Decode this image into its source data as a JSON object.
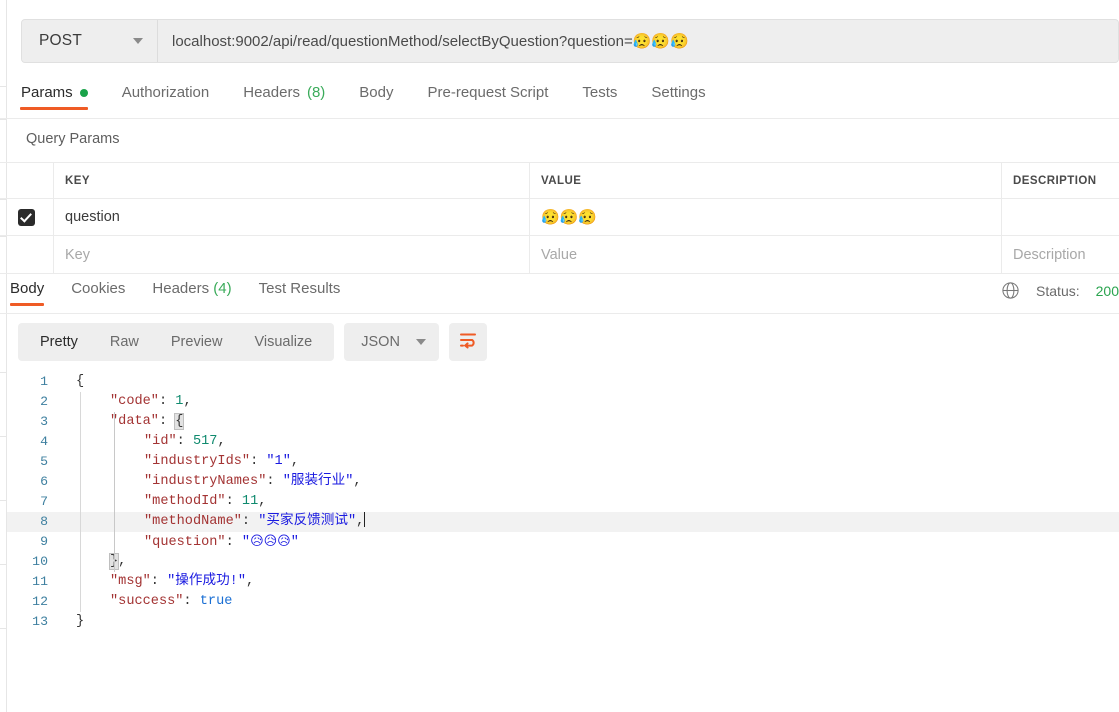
{
  "request": {
    "method": "POST",
    "method_caret": "chevron-down-icon",
    "url": "localhost:9002/api/read/questionMethod/selectByQuestion?question=",
    "url_emoji": "😥😥😥",
    "tabs": [
      {
        "label": "Params",
        "badge_dot": true,
        "active": true
      },
      {
        "label": "Authorization",
        "active": false
      },
      {
        "label": "Headers",
        "count": "(8)",
        "active": false
      },
      {
        "label": "Body",
        "active": false
      },
      {
        "label": "Pre-request Script",
        "active": false
      },
      {
        "label": "Tests",
        "active": false
      },
      {
        "label": "Settings",
        "active": false
      }
    ]
  },
  "query_params": {
    "section_title": "Query Params",
    "columns": [
      "KEY",
      "VALUE",
      "DESCRIPTION"
    ],
    "rows": [
      {
        "checked": true,
        "key": "question",
        "value": "😥😥😥",
        "description": ""
      }
    ],
    "new_row": {
      "key_placeholder": "Key",
      "value_placeholder": "Value",
      "description_placeholder": "Description"
    }
  },
  "response": {
    "tabs": [
      {
        "label": "Body",
        "active": true
      },
      {
        "label": "Cookies",
        "active": false
      },
      {
        "label": "Headers",
        "count": "(4)",
        "active": false
      },
      {
        "label": "Test Results",
        "active": false
      }
    ],
    "status_label": "Status:",
    "status_code": "200",
    "globe_icon": "globe-icon",
    "view_modes": [
      {
        "label": "Pretty",
        "active": true
      },
      {
        "label": "Raw",
        "active": false
      },
      {
        "label": "Preview",
        "active": false
      },
      {
        "label": "Visualize",
        "active": false
      }
    ],
    "format": "JSON",
    "format_caret": "chevron-down-icon",
    "wrap_button_icon": "word-wrap-icon",
    "body_lines": [
      {
        "n": "1",
        "indent": 0,
        "tokens": [
          {
            "t": "punct",
            "v": "{"
          }
        ]
      },
      {
        "n": "2",
        "indent": 1,
        "tokens": [
          {
            "t": "key",
            "v": "\"code\""
          },
          {
            "t": "punct",
            "v": ": "
          },
          {
            "t": "num",
            "v": "1"
          },
          {
            "t": "punct",
            "v": ","
          }
        ]
      },
      {
        "n": "3",
        "indent": 1,
        "tokens": [
          {
            "t": "key",
            "v": "\"data\""
          },
          {
            "t": "punct",
            "v": ": "
          },
          {
            "t": "brace",
            "v": "{"
          }
        ]
      },
      {
        "n": "4",
        "indent": 2,
        "tokens": [
          {
            "t": "key",
            "v": "\"id\""
          },
          {
            "t": "punct",
            "v": ": "
          },
          {
            "t": "num",
            "v": "517"
          },
          {
            "t": "punct",
            "v": ","
          }
        ]
      },
      {
        "n": "5",
        "indent": 2,
        "tokens": [
          {
            "t": "key",
            "v": "\"industryIds\""
          },
          {
            "t": "punct",
            "v": ": "
          },
          {
            "t": "str",
            "v": "\"1\""
          },
          {
            "t": "punct",
            "v": ","
          }
        ]
      },
      {
        "n": "6",
        "indent": 2,
        "tokens": [
          {
            "t": "key",
            "v": "\"industryNames\""
          },
          {
            "t": "punct",
            "v": ": "
          },
          {
            "t": "str",
            "v": "\"服装行业\""
          },
          {
            "t": "punct",
            "v": ","
          }
        ]
      },
      {
        "n": "7",
        "indent": 2,
        "tokens": [
          {
            "t": "key",
            "v": "\"methodId\""
          },
          {
            "t": "punct",
            "v": ": "
          },
          {
            "t": "num",
            "v": "11"
          },
          {
            "t": "punct",
            "v": ","
          }
        ]
      },
      {
        "n": "8",
        "indent": 2,
        "active": true,
        "caret": true,
        "tokens": [
          {
            "t": "key",
            "v": "\"methodName\""
          },
          {
            "t": "punct",
            "v": ": "
          },
          {
            "t": "str",
            "v": "\"买家反馈测试\""
          },
          {
            "t": "punct",
            "v": ","
          }
        ]
      },
      {
        "n": "9",
        "indent": 2,
        "tokens": [
          {
            "t": "key",
            "v": "\"question\""
          },
          {
            "t": "punct",
            "v": ": "
          },
          {
            "t": "str",
            "v": "\""
          },
          {
            "t": "emoji",
            "v": "😥😥😥"
          },
          {
            "t": "str",
            "v": "\""
          }
        ]
      },
      {
        "n": "10",
        "indent": 1,
        "tokens": [
          {
            "t": "brace",
            "v": "}"
          },
          {
            "t": "punct",
            "v": ","
          }
        ]
      },
      {
        "n": "11",
        "indent": 1,
        "tokens": [
          {
            "t": "key",
            "v": "\"msg\""
          },
          {
            "t": "punct",
            "v": ": "
          },
          {
            "t": "str",
            "v": "\"操作成功!\""
          },
          {
            "t": "punct",
            "v": ","
          }
        ]
      },
      {
        "n": "12",
        "indent": 1,
        "tokens": [
          {
            "t": "key",
            "v": "\"success\""
          },
          {
            "t": "punct",
            "v": ": "
          },
          {
            "t": "bool",
            "v": "true"
          }
        ]
      },
      {
        "n": "13",
        "indent": 0,
        "tokens": [
          {
            "t": "punct",
            "v": "}"
          }
        ]
      }
    ]
  },
  "colors": {
    "accent": "#ef5b25",
    "status_green": "#2aa44f",
    "badge_green": "#1aa34a",
    "json_key": "#a33333",
    "json_string": "#1a1ae0",
    "json_number": "#0f8a6e",
    "json_boolean": "#1a6fd4",
    "gutter": "#3f80a0"
  }
}
